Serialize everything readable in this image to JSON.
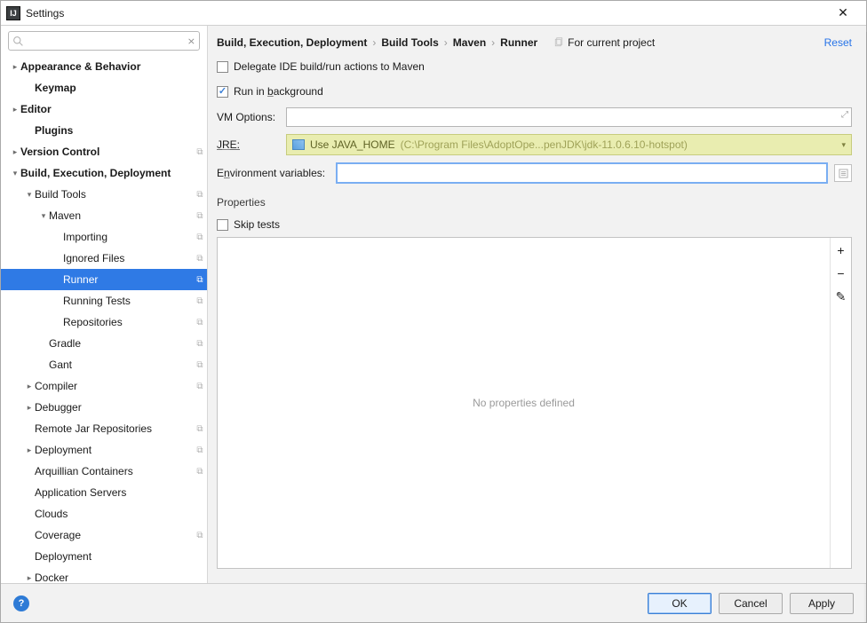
{
  "window": {
    "title": "Settings"
  },
  "search": {
    "placeholder": ""
  },
  "tree": [
    {
      "l": "Appearance & Behavior",
      "d": 0,
      "a": "r",
      "b": 1
    },
    {
      "l": "Keymap",
      "d": 1,
      "b": 1
    },
    {
      "l": "Editor",
      "d": 0,
      "a": "r",
      "b": 1
    },
    {
      "l": "Plugins",
      "d": 1,
      "b": 1
    },
    {
      "l": "Version Control",
      "d": 0,
      "a": "r",
      "b": 1,
      "cp": 1
    },
    {
      "l": "Build, Execution, Deployment",
      "d": 0,
      "a": "d",
      "b": 1
    },
    {
      "l": "Build Tools",
      "d": 1,
      "a": "d",
      "cp": 1
    },
    {
      "l": "Maven",
      "d": 2,
      "a": "d",
      "cp": 1
    },
    {
      "l": "Importing",
      "d": 3,
      "cp": 1
    },
    {
      "l": "Ignored Files",
      "d": 3,
      "cp": 1
    },
    {
      "l": "Runner",
      "d": 3,
      "cp": 1,
      "sel": 1
    },
    {
      "l": "Running Tests",
      "d": 3,
      "cp": 1
    },
    {
      "l": "Repositories",
      "d": 3,
      "cp": 1
    },
    {
      "l": "Gradle",
      "d": 2,
      "cp": 1
    },
    {
      "l": "Gant",
      "d": 2,
      "cp": 1
    },
    {
      "l": "Compiler",
      "d": 1,
      "a": "r",
      "cp": 1
    },
    {
      "l": "Debugger",
      "d": 1,
      "a": "r"
    },
    {
      "l": "Remote Jar Repositories",
      "d": 1,
      "cp": 1
    },
    {
      "l": "Deployment",
      "d": 1,
      "a": "r",
      "cp": 1
    },
    {
      "l": "Arquillian Containers",
      "d": 1,
      "cp": 1
    },
    {
      "l": "Application Servers",
      "d": 1
    },
    {
      "l": "Clouds",
      "d": 1
    },
    {
      "l": "Coverage",
      "d": 1,
      "cp": 1
    },
    {
      "l": "Deployment",
      "d": 1
    },
    {
      "l": "Docker",
      "d": 1,
      "a": "r"
    }
  ],
  "breadcrumbs": [
    "Build, Execution, Deployment",
    "Build Tools",
    "Maven",
    "Runner"
  ],
  "proj_scope": "For current project",
  "reset": "Reset",
  "form": {
    "delegate_label": "Delegate IDE build/run actions to Maven",
    "delegate_checked": false,
    "background_pre": "Run in ",
    "background_mn": "b",
    "background_post": "ackground",
    "background_checked": true,
    "vm_label": "VM Options:",
    "vm_value": "",
    "jre_pre": "J",
    "jre_mn": "R",
    "jre_post": "E:",
    "jre_text": "Use JAVA_HOME",
    "jre_path": " (C:\\Program Files\\AdoptOpe...penJDK\\jdk-11.0.6.10-hotspot)",
    "env_pre": "E",
    "env_mn": "n",
    "env_post": "vironment variables:",
    "env_value": "",
    "props_label": "Properties",
    "skip_label": "Skip tests",
    "skip_checked": false,
    "props_empty": "No properties defined"
  },
  "footer": {
    "ok": "OK",
    "cancel": "Cancel",
    "apply": "Apply"
  }
}
